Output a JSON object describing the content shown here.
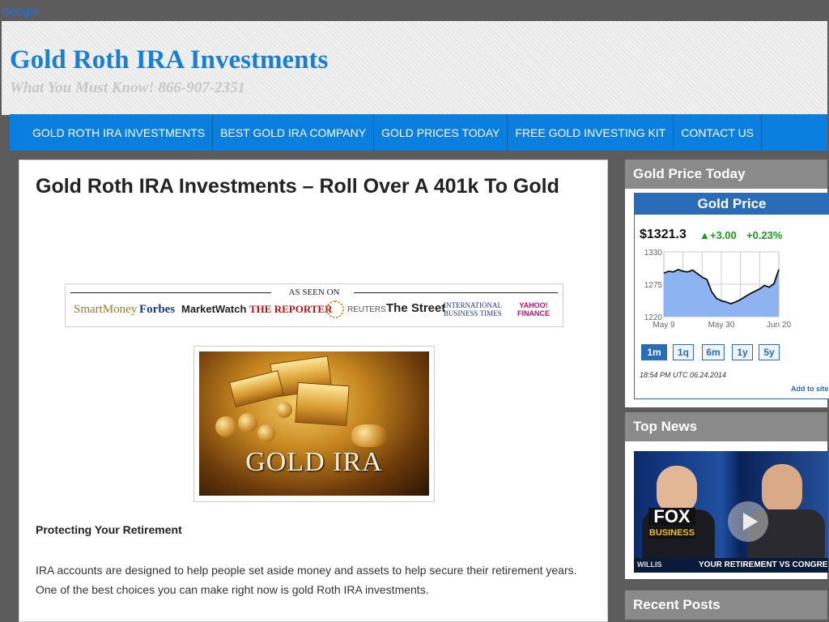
{
  "topbar": {
    "google_link": "Google"
  },
  "header": {
    "title": "Gold Roth IRA Investments",
    "tagline": "What You Must Know! 866-907-2351"
  },
  "nav": {
    "items": [
      "GOLD ROTH IRA INVESTMENTS",
      "BEST GOLD IRA COMPANY",
      "GOLD PRICES TODAY",
      "FREE GOLD INVESTING KIT",
      "CONTACT US"
    ]
  },
  "post": {
    "title": "Gold Roth IRA Investments – Roll Over A 401k To Gold",
    "as_seen_on": {
      "label": "AS SEEN ON",
      "logos": [
        "SmartMoney",
        "Forbes",
        "MarketWatch",
        "THE REPORTER",
        "REUTERS",
        "The Street",
        "INTERNATIONAL BUSINESS TIMES",
        "YAHOO! FINANCE"
      ]
    },
    "image_caption": "GOLD IRA",
    "subheading": "Protecting Your Retirement",
    "paragraph": "IRA accounts are designed to help people set aside money and assets to help secure their retirement years. One of the best choices you can make right now is gold Roth IRA investments."
  },
  "sidebar": {
    "gold_widget": {
      "heading": "Gold Price Today",
      "box_title": "Gold Price",
      "price": "$1321.3",
      "change": "▲+3.00",
      "change_pct": "+0.23%",
      "ranges": [
        "1m",
        "1q",
        "6m",
        "1y",
        "5y"
      ],
      "active_range": "1m",
      "timestamp": "18:54 PM UTC 06.24.2014",
      "add_link": "Add to site",
      "line_color": "#111111",
      "fill_color": "#8db4f0"
    },
    "news_widget": {
      "heading": "Top News",
      "badge_line1": "FOX",
      "badge_line2": "BUSINESS",
      "ticker_name": "WILLIS",
      "ticker_text": "YOUR RETIREMENT VS CONGRESS"
    },
    "recent_widget": {
      "heading": "Recent Posts"
    }
  },
  "chart_data": {
    "type": "area",
    "title": "",
    "x": [
      "May 9",
      "",
      "",
      "",
      "",
      "",
      "",
      "",
      "",
      "May 30",
      "",
      "",
      "",
      "",
      "",
      "",
      "",
      "",
      "",
      "",
      "",
      "Jun 20",
      "",
      "",
      ""
    ],
    "values": [
      1294,
      1297,
      1296,
      1300,
      1297,
      1296,
      1299,
      1293,
      1287,
      1283,
      1262,
      1251,
      1247,
      1245,
      1242,
      1245,
      1249,
      1254,
      1259,
      1263,
      1267,
      1273,
      1270,
      1276,
      1300
    ],
    "xticks": [
      "May 9",
      "May 30",
      "Jun 20"
    ],
    "yticks": [
      1220,
      1275,
      1330
    ],
    "ylim": [
      1220,
      1330
    ],
    "grid": true
  }
}
